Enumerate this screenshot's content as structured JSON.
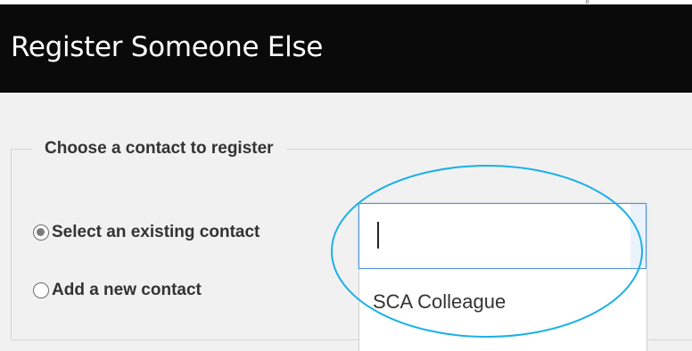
{
  "header": {
    "title": "Register Someone Else"
  },
  "form": {
    "legend": "Choose a contact to register",
    "options": [
      {
        "label": "Select an existing contact",
        "checked": true
      },
      {
        "label": "Add a new contact",
        "checked": false
      }
    ],
    "contact_search": {
      "value": "",
      "placeholder": ""
    },
    "dropdown": {
      "items": [
        "SCA Colleague"
      ]
    }
  },
  "colors": {
    "header_bg": "#0a0a0a",
    "body_bg": "#f1f1f1",
    "input_focus_border": "#4a90d9",
    "annotation_ellipse": "#1ab0e8"
  }
}
